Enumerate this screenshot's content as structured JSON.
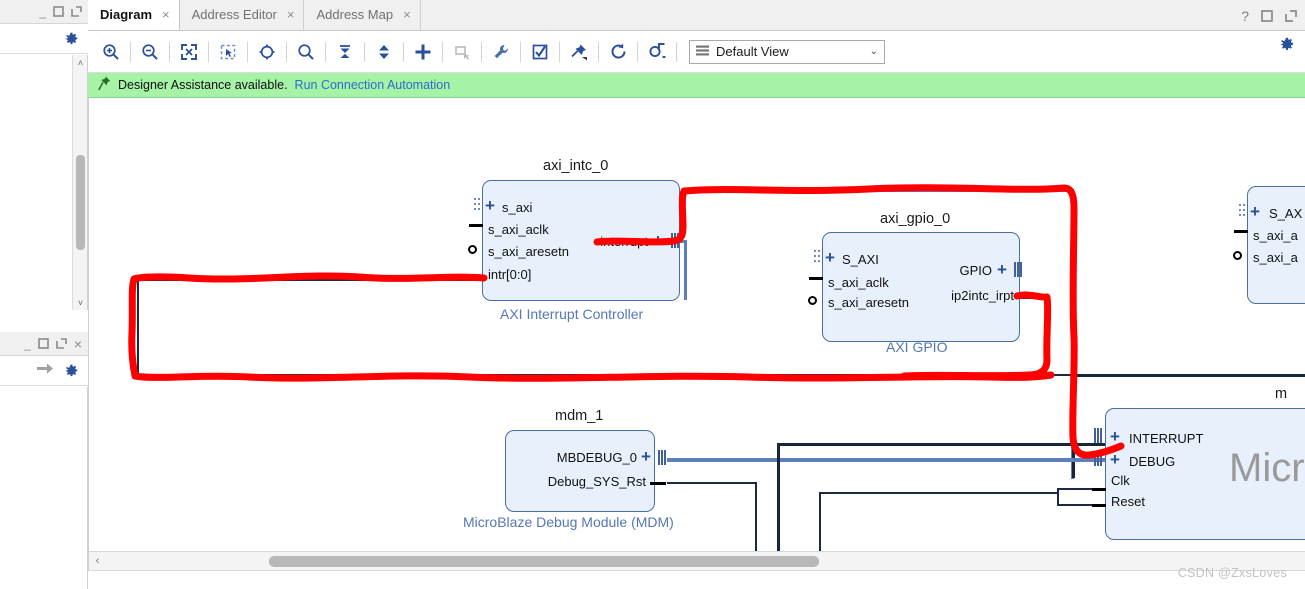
{
  "tabs": [
    {
      "label": "Diagram",
      "active": true,
      "close": "×"
    },
    {
      "label": "Address Editor",
      "active": false,
      "close": "×"
    },
    {
      "label": "Address Map",
      "active": false,
      "close": "×"
    }
  ],
  "window_controls": {
    "help": "?",
    "maximize": "□",
    "float": "↗",
    "minimize": "_",
    "close": "×"
  },
  "toolbar": {
    "buttons": [
      {
        "name": "zoom-in-icon",
        "title": "Zoom In"
      },
      {
        "name": "zoom-out-icon",
        "title": "Zoom Out"
      },
      {
        "name": "zoom-fit-icon",
        "title": "Zoom Fit"
      },
      {
        "name": "zoom-area-icon",
        "title": "Zoom Area"
      },
      {
        "name": "fit-selection-icon",
        "title": "Fit Selection"
      },
      {
        "name": "search-icon",
        "title": "Search"
      },
      {
        "name": "collapse-all-icon",
        "title": "Collapse All"
      },
      {
        "name": "expand-all-icon",
        "title": "Expand All"
      },
      {
        "name": "add-ip-icon",
        "title": "Add IP"
      },
      {
        "name": "add-module-icon",
        "title": "Add Module"
      },
      {
        "name": "settings-wrench-icon",
        "title": "Customize Block"
      },
      {
        "name": "validate-design-icon",
        "title": "Validate Design"
      },
      {
        "name": "pin-icon",
        "title": "Pin Lower Panel"
      },
      {
        "name": "regenerate-layout-icon",
        "title": "Regenerate Layout"
      },
      {
        "name": "optimize-routing-icon",
        "title": "Optimize Routing"
      }
    ],
    "view_select": {
      "value": "Default View",
      "caret": "⌄",
      "menu_icon": "list-icon"
    },
    "settings_icon": "gear-icon"
  },
  "banner": {
    "icon": "assistant-pin-icon",
    "text": "Designer Assistance available.",
    "link": "Run Connection Automation"
  },
  "blocks": [
    {
      "id": "axi_intc_0",
      "title": "axi_intc_0",
      "subtitle": "AXI Interrupt Controller",
      "inputs": [
        "s_axi",
        "s_axi_aclk",
        "s_axi_aresetn",
        "intr[0:0]"
      ],
      "outputs": [
        "interrupt"
      ]
    },
    {
      "id": "axi_gpio_0",
      "title": "axi_gpio_0",
      "subtitle": "AXI GPIO",
      "inputs": [
        "S_AXI",
        "s_axi_aclk",
        "s_axi_aresetn"
      ],
      "outputs": [
        "GPIO",
        "ip2intc_irpt"
      ]
    },
    {
      "id": "mdm_1",
      "title": "mdm_1",
      "subtitle": "MicroBlaze Debug Module (MDM)",
      "inputs": [],
      "outputs": [
        "MBDEBUG_0",
        "Debug_SYS_Rst"
      ]
    },
    {
      "id": "microblaze_0",
      "title": "m",
      "bigname": "Micr",
      "inputs": [
        "INTERRUPT",
        "DEBUG",
        "Clk",
        "Reset"
      ],
      "outputs": []
    },
    {
      "id": "clipped_right",
      "title": "",
      "inputs": [
        "S_AX",
        "s_axi_a",
        "s_axi_a"
      ],
      "outputs": []
    }
  ],
  "left_panel_top": {
    "minimize": "_",
    "maximize": "□",
    "float": "↗",
    "gear": "gear-icon"
  },
  "left_panel_bottom": {
    "minimize": "_",
    "maximize": "□",
    "float": "↗",
    "close": "×",
    "arrow": "➜",
    "gear": "gear-icon"
  },
  "scrollbars": {
    "h_left_arrow": "‹",
    "v_up_arrow": "˄",
    "v_down_arrow": "˅"
  },
  "watermark": "CSDN @ZxsLoves",
  "colors": {
    "banner_bg": "#a6f2a6",
    "link": "#2a6fc9",
    "block_fill": "#e8f0fb",
    "block_border": "#4a6fa5",
    "block_label": "#5577b5",
    "wire": "#5f7fb8",
    "wire_dark": "#17263b",
    "annotation": "#ff0000"
  }
}
